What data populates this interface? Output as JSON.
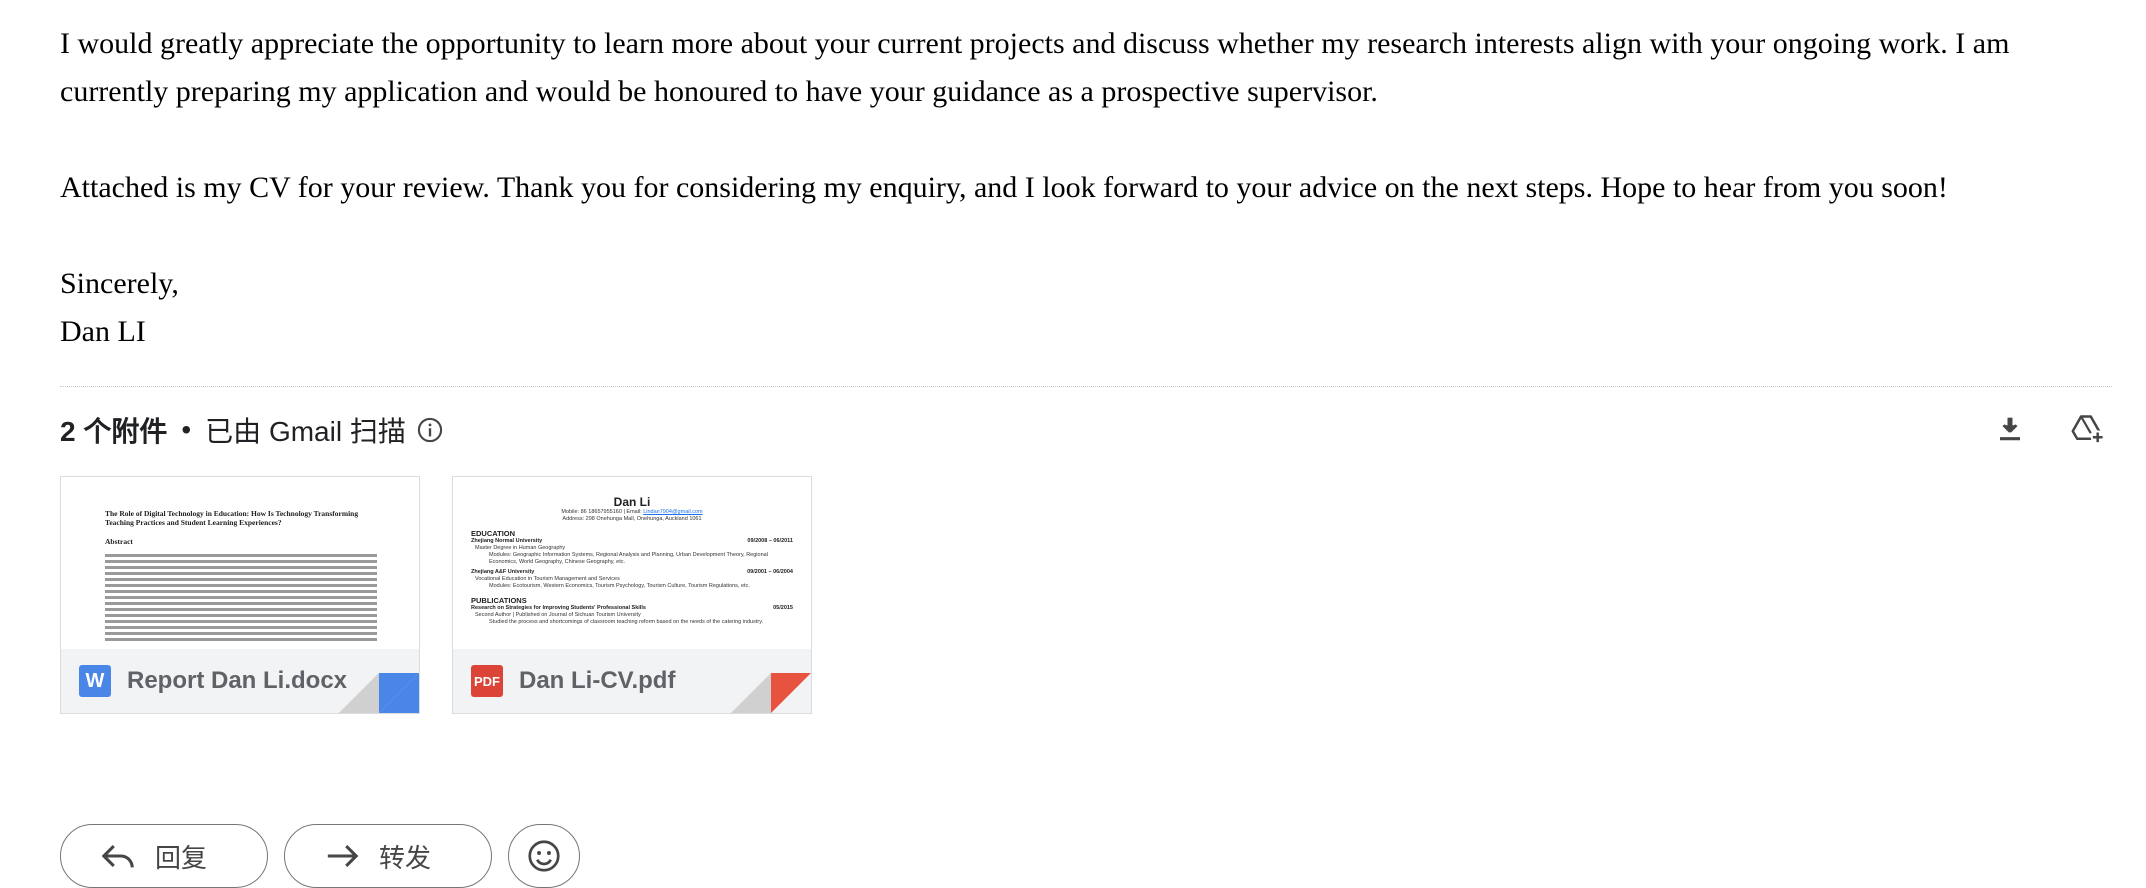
{
  "email": {
    "paragraphs": [
      "I would greatly appreciate the opportunity to learn more about your current projects and discuss whether my research interests align with your ongoing work. I am currently preparing my application and would be honoured to have your guidance as a prospective supervisor.",
      "Attached is my CV for your review. Thank you for considering my enquiry, and I look forward to your advice on the next steps. Hope to hear from you soon!"
    ],
    "closing": "Sincerely,",
    "signature": "Dan LI"
  },
  "attachments": {
    "count_label": "2 个附件",
    "separator": "•",
    "scan_label": "已由 Gmail 扫描",
    "info_icon": "info-icon",
    "download_icon": "download-icon",
    "drive_icon": "add-to-drive-icon",
    "files": [
      {
        "name": "Report Dan Li.docx",
        "type_letter": "W",
        "accent": "#4a86e8",
        "preview": {
          "title": "The Role of Digital Technology in Education: How Is Technology Transforming Teaching Practices and Student Learning Experiences?",
          "heading": "Abstract"
        }
      },
      {
        "name": "Dan Li-CV.pdf",
        "type_letter": "PDF",
        "accent": "#db4437",
        "preview": {
          "name": "Dan Li",
          "contact": "Mobile: 86 18657955160 | Email: ",
          "email": "Lindan7904@gmail.com",
          "address": "Address: 298 Onehunga Mall, Onehunga, Auckland 1061",
          "education_heading": "EDUCATION",
          "edu1_school": "Zhejiang Normal University",
          "edu1_dates": "09/2008 – 06/2011",
          "edu1_degree": "Master Degree in Human Geography",
          "edu1_modules": "Modules: Geographic Information Systems, Regional Analysis and Planning, Urban Development Theory, Regional Economics, World Geography, Chinese Geography, etc.",
          "edu2_school": "Zhejiang A&F University",
          "edu2_dates": "09/2001 – 06/2004",
          "edu2_degree": "Vocational Education in Tourism Management and Services",
          "edu2_modules": "Modules: Ecotourism, Western Economics, Tourism Psychology, Tourism Culture, Tourism Regulations, etc.",
          "pub_heading": "PUBLICATIONS",
          "pub1_title": "Research on Strategies for Improving Students' Professional Skills",
          "pub1_date": "05/2015",
          "pub1_detail": "Second Author | Published on Journal of Sichuan Tourism University",
          "pub1_bullet": "Studied the process and shortcomings of classroom teaching reform based on the needs of the catering industry."
        }
      }
    ]
  },
  "actions": {
    "reply_label": "回复",
    "forward_label": "转发",
    "reply_icon": "reply-arrow-icon",
    "forward_icon": "forward-arrow-icon",
    "emoji_icon": "emoji-icon"
  }
}
